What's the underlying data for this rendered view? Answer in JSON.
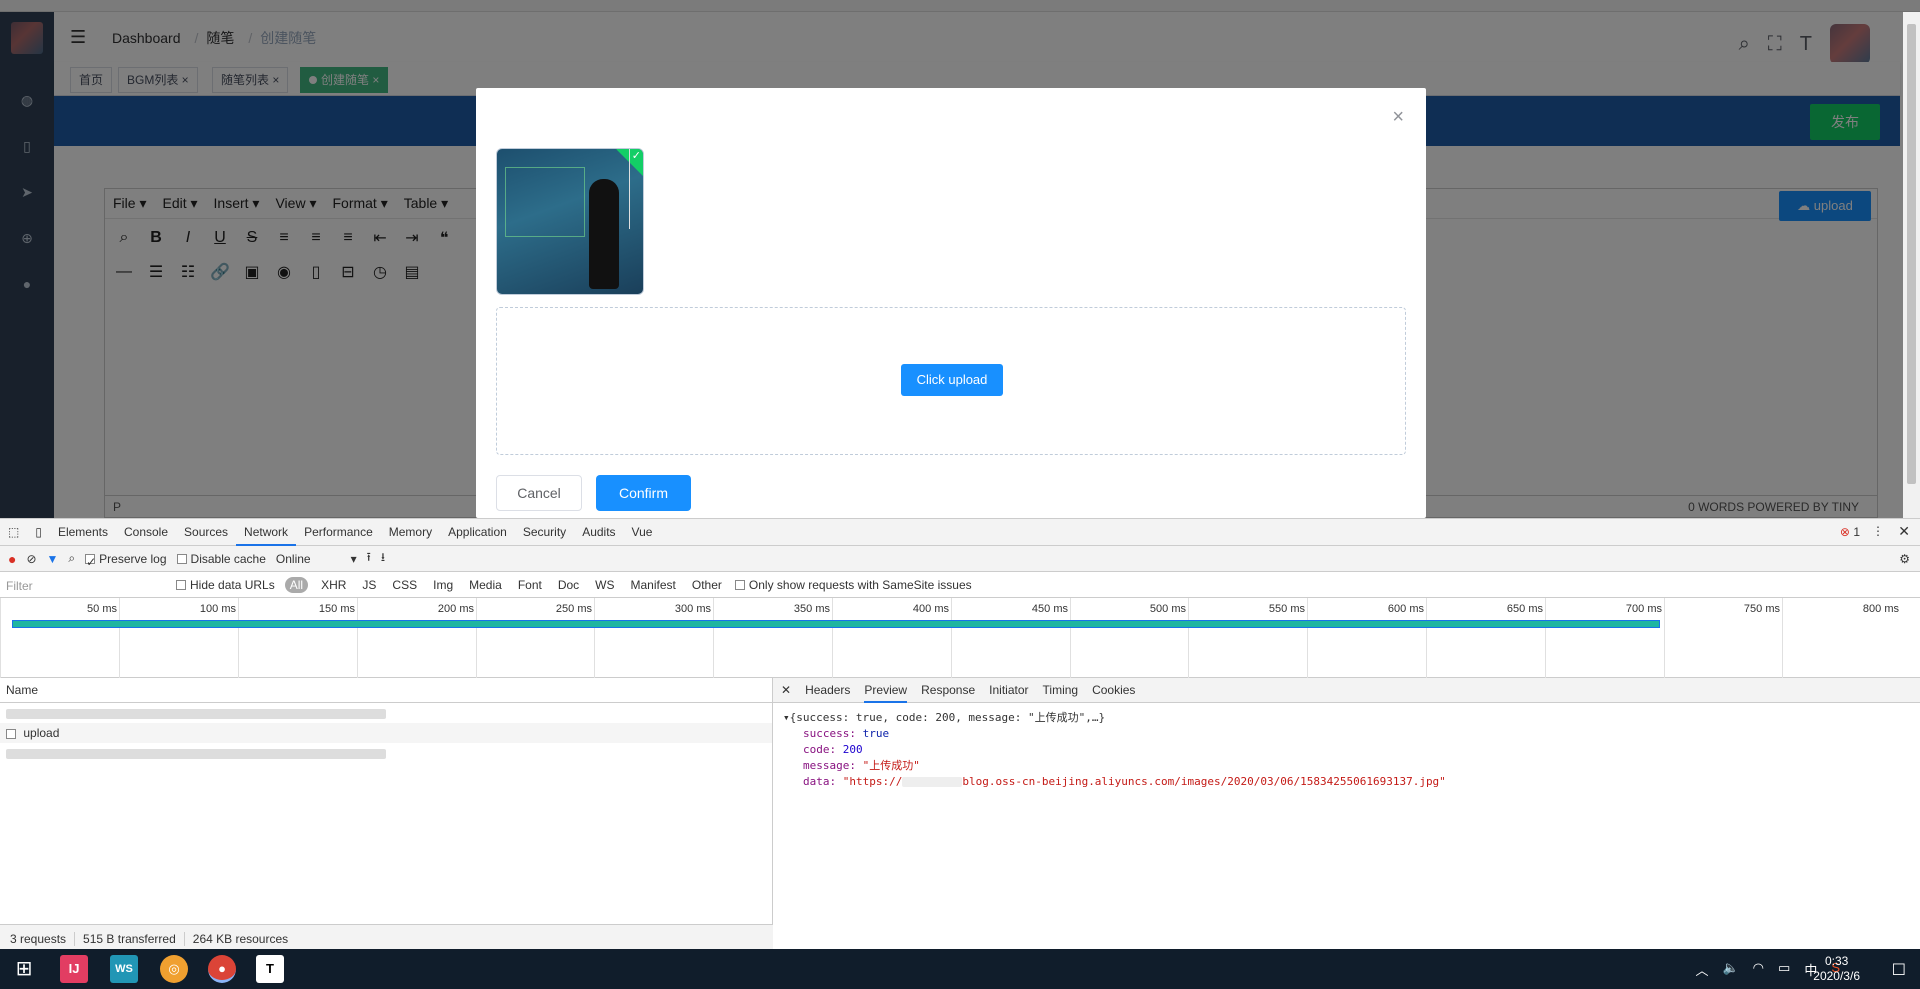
{
  "breadcrumb": {
    "dashboard": "Dashboard",
    "notes": "随笔",
    "create": "创建随笔"
  },
  "tags": {
    "home": "首页",
    "bgm": "BGM列表",
    "notes_list": "随笔列表",
    "create": "创建随笔"
  },
  "publish_label": "发布",
  "editor": {
    "menus": [
      "File",
      "Edit",
      "Insert",
      "View",
      "Format",
      "Table"
    ],
    "upload_label": "upload",
    "status_left": "P",
    "status_right": "0 WORDS POWERED BY TINY"
  },
  "modal": {
    "close": "×",
    "click_upload": "Click upload",
    "cancel": "Cancel",
    "confirm": "Confirm"
  },
  "devtools": {
    "tabs": [
      "Elements",
      "Console",
      "Sources",
      "Network",
      "Performance",
      "Memory",
      "Application",
      "Security",
      "Audits",
      "Vue"
    ],
    "active_tab": "Network",
    "error_count": "1",
    "preserve_log": "Preserve log",
    "disable_cache": "Disable cache",
    "throttle": "Online",
    "filter_placeholder": "Filter",
    "hide_data_urls": "Hide data URLs",
    "types": [
      "All",
      "XHR",
      "JS",
      "CSS",
      "Img",
      "Media",
      "Font",
      "Doc",
      "WS",
      "Manifest",
      "Other"
    ],
    "samesite": "Only show requests with SameSite issues",
    "timeline_ticks": [
      "50 ms",
      "100 ms",
      "150 ms",
      "200 ms",
      "250 ms",
      "300 ms",
      "350 ms",
      "400 ms",
      "450 ms",
      "500 ms",
      "550 ms",
      "600 ms",
      "650 ms",
      "700 ms",
      "750 ms",
      "800 ms"
    ],
    "name_header": "Name",
    "request_name": "upload",
    "summary": {
      "requests": "3 requests",
      "transferred": "515 B transferred",
      "resources": "264 KB resources"
    },
    "preview_tabs": [
      "Headers",
      "Preview",
      "Response",
      "Initiator",
      "Timing",
      "Cookies"
    ],
    "active_preview_tab": "Preview",
    "json": {
      "summary": "{success: true, code: 200, message: \"上传成功\",…}",
      "success_key": "success:",
      "success_val": "true",
      "code_key": "code:",
      "code_val": "200",
      "message_key": "message:",
      "message_val": "\"上传成功\"",
      "data_key": "data:",
      "data_val": "\"https://",
      "data_val_tail": "blog.oss-cn-beijing.aliyuncs.com/images/2020/03/06/15834255061693137.jpg\""
    }
  },
  "taskbar": {
    "time": "0:33",
    "date": "2020/3/6",
    "ime": "中"
  }
}
